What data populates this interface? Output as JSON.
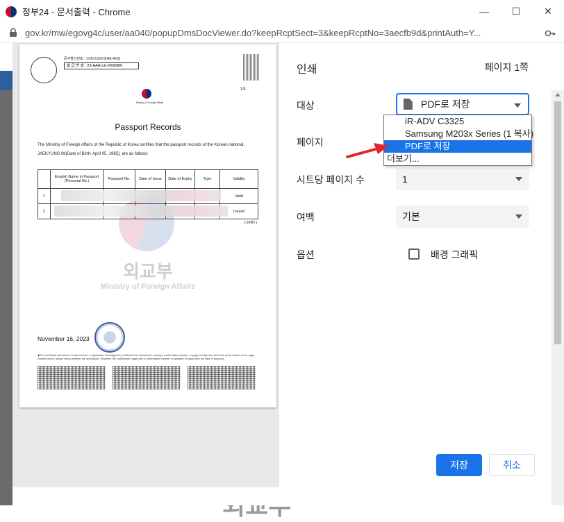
{
  "window": {
    "title": "정부24 - 문서출력 - Chrome",
    "controls": {
      "minimize": "—",
      "maximize": "☐",
      "close": "✕"
    }
  },
  "address_bar": {
    "url": "gov.kr/mw/egovg4c/user/aa040/popupDmsDocViewer.do?keepRcptSect=3&keepRcptNo=3aecfb9d&printAuth=Y..."
  },
  "print_dialog": {
    "title": "인쇄",
    "page_count": "페이지 1쪽",
    "destination": {
      "label": "대상",
      "value": "PDF로 저장"
    },
    "destination_options": [
      "iR-ADV C3325",
      "Samsung M203x Series (1 복사)",
      "PDF로 저장",
      "더보기..."
    ],
    "selected_option_index": 2,
    "pages": {
      "label": "페이지"
    },
    "pages_per_sheet": {
      "label": "시트당 페이지 수",
      "value": "1"
    },
    "margins": {
      "label": "여백",
      "value": "기본"
    },
    "options": {
      "label": "옵션",
      "background_graphics_label": "배경 그래픽",
      "background_graphics_checked": false
    },
    "save_button": "저장",
    "cancel_button": "취소"
  },
  "document": {
    "issue_number_line": "문서확인번호 : 1700-1000-5048-4630",
    "issue_box": "발 급 번 호 : 23-AAA-LE-0036980",
    "page_indicator": "1/1",
    "ministry_small": "Ministry of Foreign Affairs",
    "heading": "Passport Records",
    "body": "The Ministry of Foreign Affairs of the Republic of Korea certifies that the passport records of the Korean national, JAEKYUNG IM(Date of Birth: April    05, 1985), are as follows:",
    "table_headers": [
      "",
      "English Name in Passport (Personal No.)",
      "Passport No.",
      "Date of Issue",
      "Date of Expiry",
      "Type",
      "Validity"
    ],
    "table_rows": [
      {
        "no": "1",
        "validity": "Valid"
      },
      {
        "no": "2",
        "validity": "Invalid"
      }
    ],
    "end_mark": "[ END ]",
    "watermark_ko": "외교부",
    "watermark_en": "Ministry of Foreign Affairs",
    "date": "November 16, 2023",
    "footnote": "◆The certificate was issued on the Internet. e-application Gov24(gov.kr) confirmed the document's issuing a confirmation number, or page through the menu bar at the bottom of the page content above, please check whether the modulation. However, the confirmation page with a confirmation number is available 90 days from the date of issuance."
  },
  "background_page": {
    "partial_text": "외교부"
  },
  "colors": {
    "accent": "#1a73e8",
    "selected": "#1a73e8",
    "arrow": "#e0262b"
  }
}
